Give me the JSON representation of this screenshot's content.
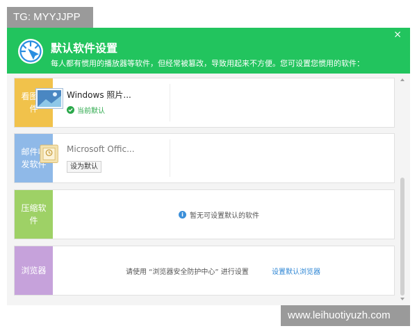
{
  "watermark": {
    "top": "TG: MYYJJPP",
    "bottom": "www.leihuotiyuzh.com"
  },
  "dialog": {
    "title": "默认软件设置",
    "subtitle": "每人都有惯用的播放器等软件，但经常被篡改，导致用起来不方便。您可设置您惯用的软件：",
    "close": "×"
  },
  "colors": {
    "header": "#22c45e",
    "image_category": "#f1c24b",
    "mail_category": "#8fb9e8",
    "compress_category": "#9ed166",
    "browser_category": "#c6a2db",
    "link": "#2e86d4",
    "status": "#2aa84a"
  },
  "categories": [
    {
      "label": "看图软件",
      "app": "Windows 照片...",
      "status": "当前默认",
      "icon": "photo-viewer-icon"
    },
    {
      "label": "邮件收发软件",
      "app": "Microsoft Offic...",
      "action": "设为默认",
      "icon": "outlook-icon"
    },
    {
      "label": "压缩软件",
      "notice": "暂无可设置默认的软件",
      "icon": "info-icon"
    },
    {
      "label": "浏览器",
      "hint": "请使用 “浏览器安全防护中心” 进行设置",
      "link": "设置默认浏览器"
    }
  ]
}
